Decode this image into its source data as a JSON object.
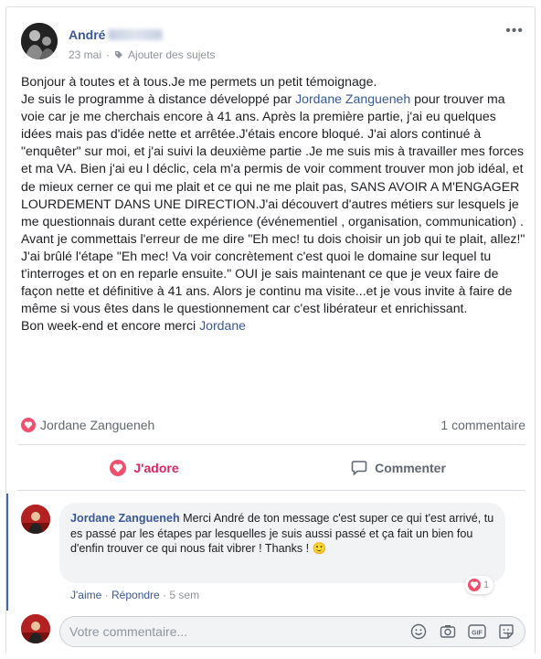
{
  "post": {
    "author_name": "André",
    "date": "23 mai",
    "separator": "·",
    "tags_label": "Ajouter des sujets",
    "body": [
      {
        "text": "Bonjour à toutes et à tous.Je me permets un petit témoignage."
      },
      {
        "pre": "Je suis le programme à distance développé par ",
        "link": "Jordane Zangueneh",
        "post": " pour trouver ma voie car je me cherchais encore à 41 ans. Après la première partie, j'ai eu quelques idées mais pas d'idée nette et arrêtée.J'étais encore bloqué. J'ai alors continué à \"enquêter\" sur moi, et j'ai suivi la deuxième partie .Je me suis mis à travailler mes forces et ma VA. Bien j'ai eu l déclic, cela m'a permis de voir comment trouver mon job idéal, et de mieux cerner ce qui me plait et ce qui ne me plait pas, SANS AVOIR A M'ENGAGER LOURDEMENT DANS UNE DIRECTION.J'ai découvert d'autres métiers sur lesquels je me questionnais durant cette expérience (événementiel , organisation, communication) . Avant je commettais l'erreur de me dire \"Eh mec! tu dois choisir un job qui te plait, allez!\" J'ai brûlé l'étape \"Eh mec! Va voir concrètement c'est quoi le domaine sur lequel tu t'interroges et on en reparle ensuite.\" OUI je sais maintenant ce que je veux faire de façon nette et définitive à 41 ans. Alors je continu ma visite...et je vous invite à faire de même si vous êtes dans le questionnement car c'est libérateur et enrichissant."
      },
      {
        "pre": "Bon week-end et encore merci ",
        "link": "Jordane",
        "post": ""
      }
    ]
  },
  "summary": {
    "reactor": "Jordane Zangueneh",
    "comment_count": "1 commentaire"
  },
  "actions": {
    "love_label": "J'adore",
    "comment_label": "Commenter"
  },
  "comment": {
    "author": "Jordane Zangueneh",
    "text": "Merci André de ton message c'est super ce qui t'est arrivé, tu es passé par les étapes par lesquelles je suis aussi passé et ça fait un bien fou d'enfin trouver ce qui nous fait vibrer ! Thanks ! 🙂",
    "reaction_count": "1",
    "like_label": "J'aime",
    "reply_label": "Répondre",
    "dot": "·",
    "time": "5 sem"
  },
  "composer": {
    "placeholder": "Votre commentaire..."
  },
  "icons": {
    "more": "more-icon",
    "tag": "tag-icon",
    "love": "love-icon",
    "comment": "comment-icon",
    "emoji": "emoji-icon",
    "camera": "camera-icon",
    "gif": "gif-icon",
    "sticker": "sticker-icon"
  },
  "colors": {
    "link": "#385898",
    "love": "#e0245e",
    "love_badge": "#f0506e",
    "muted": "#90949c",
    "accent_bar": "#4267b2"
  }
}
